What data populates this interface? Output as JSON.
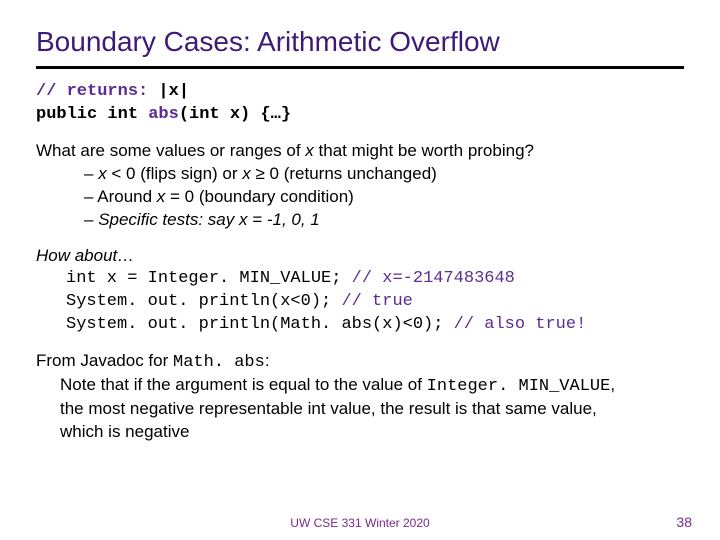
{
  "title": "Boundary Cases: Arithmetic Overflow",
  "code_top": {
    "l1a": "// returns:",
    "l1b": " |x|",
    "l2a": "public int ",
    "l2b": "abs",
    "l2c": "(int x) {…}"
  },
  "question": {
    "pre": "What are some values or ranges of ",
    "x": "x",
    "post": " that might be worth probing?"
  },
  "bullets": {
    "b1_x1": "x",
    "b1_mid": " < 0 (flips sign) or ",
    "b1_x2": "x",
    "b1_end": " ≥ 0 (returns unchanged)",
    "b2_pre": "Around ",
    "b2_x": "x",
    "b2_end": " = 0 (boundary condition)",
    "b3": "Specific tests: say x = -1, 0, 1"
  },
  "howabout": "How about…",
  "codeblock": {
    "l1": "int x = Integer. MIN_VALUE;",
    "l1c": " // x=-2147483648",
    "l2": "System. out. println(x<0);  ",
    "l2c": " // true",
    "l3": "System. out. println(Math. abs(x)<0);",
    "l3c": " // also true!"
  },
  "from": {
    "pre": "From Javadoc for ",
    "code": "Math. abs",
    "post": ":"
  },
  "note": {
    "t1": "Note that if the argument is equal to the value of ",
    "code": "Integer. MIN_VALUE",
    "t2": ", the most negative representable int value, the result is that same value, which is negative"
  },
  "footer_center": "UW CSE 331 Winter 2020",
  "footer_right": "38"
}
